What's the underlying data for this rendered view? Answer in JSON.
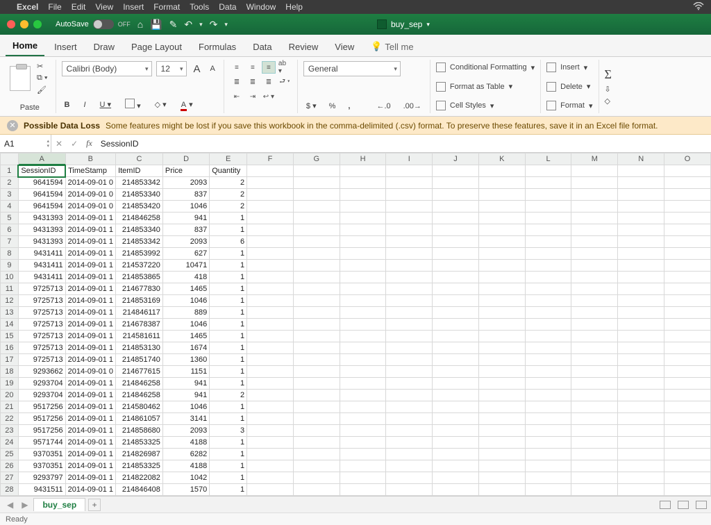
{
  "mac_menu": {
    "apple": "",
    "app": "Excel",
    "items": [
      "File",
      "Edit",
      "View",
      "Insert",
      "Format",
      "Tools",
      "Data",
      "Window",
      "Help"
    ]
  },
  "titlebar": {
    "autosave_label": "AutoSave",
    "autosave_state": "OFF",
    "doc_title": "buy_sep"
  },
  "ribbon_tabs": [
    "Home",
    "Insert",
    "Draw",
    "Page Layout",
    "Formulas",
    "Data",
    "Review",
    "View"
  ],
  "tell_me": "Tell me",
  "ribbon": {
    "paste": "Paste",
    "font_name": "Calibri (Body)",
    "font_size": "12",
    "bold": "B",
    "italic": "I",
    "underline": "U",
    "bigA": "A",
    "smallA": "A",
    "number_format": "General",
    "currency": "$",
    "percent": "%",
    "comma": ",",
    "dec_inc": ".0",
    "dec_dec": ".00",
    "cond_fmt": "Conditional Formatting",
    "fmt_table": "Format as Table",
    "cell_styles": "Cell Styles",
    "insert": "Insert",
    "delete": "Delete",
    "format": "Format"
  },
  "warning": {
    "title": "Possible Data Loss",
    "msg": "Some features might be lost if you save this workbook in the comma-delimited (.csv) format. To preserve these features, save it in an Excel file format."
  },
  "formula_bar": {
    "cell_ref": "A1",
    "fx": "fx",
    "value": "SessionID"
  },
  "columns": [
    "A",
    "B",
    "C",
    "D",
    "E",
    "F",
    "G",
    "H",
    "I",
    "J",
    "K",
    "L",
    "M",
    "N",
    "O"
  ],
  "headers": [
    "SessionID",
    "TimeStamp",
    "ItemID",
    "Price",
    "Quantity"
  ],
  "rows": [
    {
      "n": 2,
      "a": "9641594",
      "b": "2014-09-01 0",
      "c": "214853342",
      "d": "2093",
      "e": "2"
    },
    {
      "n": 3,
      "a": "9641594",
      "b": "2014-09-01 0",
      "c": "214853340",
      "d": "837",
      "e": "2"
    },
    {
      "n": 4,
      "a": "9641594",
      "b": "2014-09-01 0",
      "c": "214853420",
      "d": "1046",
      "e": "2"
    },
    {
      "n": 5,
      "a": "9431393",
      "b": "2014-09-01 1",
      "c": "214846258",
      "d": "941",
      "e": "1"
    },
    {
      "n": 6,
      "a": "9431393",
      "b": "2014-09-01 1",
      "c": "214853340",
      "d": "837",
      "e": "1"
    },
    {
      "n": 7,
      "a": "9431393",
      "b": "2014-09-01 1",
      "c": "214853342",
      "d": "2093",
      "e": "6"
    },
    {
      "n": 8,
      "a": "9431411",
      "b": "2014-09-01 1",
      "c": "214853992",
      "d": "627",
      "e": "1"
    },
    {
      "n": 9,
      "a": "9431411",
      "b": "2014-09-01 1",
      "c": "214537220",
      "d": "10471",
      "e": "1"
    },
    {
      "n": 10,
      "a": "9431411",
      "b": "2014-09-01 1",
      "c": "214853865",
      "d": "418",
      "e": "1"
    },
    {
      "n": 11,
      "a": "9725713",
      "b": "2014-09-01 1",
      "c": "214677830",
      "d": "1465",
      "e": "1"
    },
    {
      "n": 12,
      "a": "9725713",
      "b": "2014-09-01 1",
      "c": "214853169",
      "d": "1046",
      "e": "1"
    },
    {
      "n": 13,
      "a": "9725713",
      "b": "2014-09-01 1",
      "c": "214846117",
      "d": "889",
      "e": "1"
    },
    {
      "n": 14,
      "a": "9725713",
      "b": "2014-09-01 1",
      "c": "214678387",
      "d": "1046",
      "e": "1"
    },
    {
      "n": 15,
      "a": "9725713",
      "b": "2014-09-01 1",
      "c": "214581611",
      "d": "1465",
      "e": "1"
    },
    {
      "n": 16,
      "a": "9725713",
      "b": "2014-09-01 1",
      "c": "214853130",
      "d": "1674",
      "e": "1"
    },
    {
      "n": 17,
      "a": "9725713",
      "b": "2014-09-01 1",
      "c": "214851740",
      "d": "1360",
      "e": "1"
    },
    {
      "n": 18,
      "a": "9293662",
      "b": "2014-09-01 0",
      "c": "214677615",
      "d": "1151",
      "e": "1"
    },
    {
      "n": 19,
      "a": "9293704",
      "b": "2014-09-01 1",
      "c": "214846258",
      "d": "941",
      "e": "1"
    },
    {
      "n": 20,
      "a": "9293704",
      "b": "2014-09-01 1",
      "c": "214846258",
      "d": "941",
      "e": "2"
    },
    {
      "n": 21,
      "a": "9517256",
      "b": "2014-09-01 1",
      "c": "214580462",
      "d": "1046",
      "e": "1"
    },
    {
      "n": 22,
      "a": "9517256",
      "b": "2014-09-01 1",
      "c": "214861057",
      "d": "3141",
      "e": "1"
    },
    {
      "n": 23,
      "a": "9517256",
      "b": "2014-09-01 1",
      "c": "214858680",
      "d": "2093",
      "e": "3"
    },
    {
      "n": 24,
      "a": "9571744",
      "b": "2014-09-01 1",
      "c": "214853325",
      "d": "4188",
      "e": "1"
    },
    {
      "n": 25,
      "a": "9370351",
      "b": "2014-09-01 1",
      "c": "214826987",
      "d": "6282",
      "e": "1"
    },
    {
      "n": 26,
      "a": "9370351",
      "b": "2014-09-01 1",
      "c": "214853325",
      "d": "4188",
      "e": "1"
    },
    {
      "n": 27,
      "a": "9293797",
      "b": "2014-09-01 1",
      "c": "214822082",
      "d": "1042",
      "e": "1"
    },
    {
      "n": 28,
      "a": "9431511",
      "b": "2014-09-01 1",
      "c": "214846408",
      "d": "1570",
      "e": "1"
    }
  ],
  "sheet_tab": "buy_sep",
  "status": "Ready"
}
